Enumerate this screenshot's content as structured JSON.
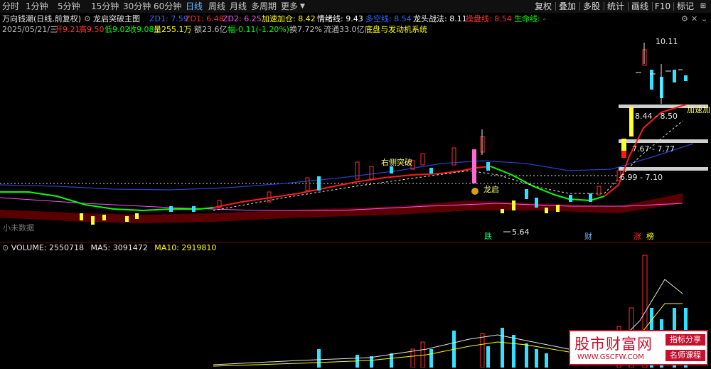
{
  "toolbar": {
    "periods": [
      "分时",
      "1分钟",
      "5分钟",
      "15分钟",
      "30分钟",
      "60分钟",
      "日线",
      "周线",
      "月线",
      "多周期",
      "更多"
    ],
    "active_period": "日线",
    "right_buttons": [
      "复权",
      "叠加",
      "多股",
      "统计",
      "画线",
      "F10",
      "标记"
    ],
    "colors": {
      "active": "#6ab7ff",
      "text": "#c8c8c8"
    }
  },
  "info": {
    "stock_name": "万向钱潮(日线,前复权)",
    "indicator_name": "龙启突破主图",
    "zd1_label": "ZD1: 7.59",
    "zd2_label": "ZD1: 6.48",
    "zd3_label": "ZD2: 6.25",
    "jiasu_label": "加速加仓: 8.42",
    "qingxu_label": "情绪线: 9.43",
    "duokong_label": "多空线: 8.54",
    "longtou_label": "龙头战法: 8.11",
    "caopan_label": "操盘线: 8.54",
    "shengming_label": "生命线: -",
    "colors": {
      "name": "#e8e8e8",
      "blue": "#2f6bff",
      "red": "#ff3030",
      "pink": "#ff50ff",
      "yellow": "#ffff00",
      "white": "#ffffff",
      "green": "#00ff00"
    }
  },
  "quote": {
    "date": "2025/05/21/三",
    "open": "开9.21",
    "high": "高9.50",
    "low": "低9.02",
    "close": "收9.08",
    "volume": "量255.1万",
    "amount": "额23.6亿",
    "change": "幅-0.11(-1.20%)",
    "turnover": "换7.72%",
    "float": "流通33.0亿",
    "system": "底盘与发动机系统"
  },
  "chart_labels": {
    "price_high": "10.11",
    "price_low": "5.64",
    "zone1": "8.44 - 8.50",
    "zone2": "7.67 - 7.77",
    "zone3": "6.99 - 7.10",
    "breakout": "右侧突破",
    "dragon": "龙启",
    "accelerate": "加速加",
    "no_data": "小未数据",
    "marker_die": "跌",
    "marker_cai": "财",
    "marker_zhang": "涨",
    "marker_bang": "榜"
  },
  "volume_info": {
    "volume": "VOLUME: 2550718",
    "ma5": "MA5: 3091472",
    "ma10": "MA10: 2919810"
  },
  "watermark": {
    "title": "股市财富网",
    "url": "WWW.GSCFW.COM",
    "tag1": "指标分享",
    "tag2": "名师课程"
  }
}
